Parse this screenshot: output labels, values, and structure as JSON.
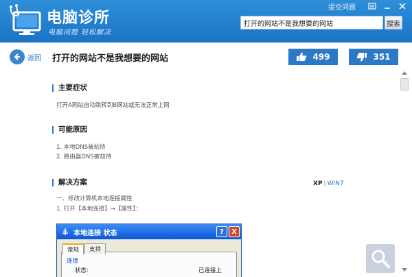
{
  "app": {
    "title": "电脑诊所",
    "slogan": "电脑问题  轻松解决"
  },
  "topbar": {
    "feedback": "提交问题"
  },
  "search": {
    "value": "打开的网站不是我想要的网站",
    "button_label": "搜索"
  },
  "nav": {
    "back_label": "返回"
  },
  "article": {
    "title": "打开的网站不是我想要的网站",
    "upvotes": "499",
    "downvotes": "351",
    "sections": [
      {
        "title": "主要症状",
        "lines": [
          "打开A网站自动跳转到B网站或无法正常上网"
        ]
      },
      {
        "title": "可能原因",
        "lines": [
          "1. 本地DNS被劫持",
          "2. 路由器DNS被劫持"
        ]
      },
      {
        "title": "解决方案",
        "lines": [
          "一、修改计算机本地连接属性",
          "1. 打开【本地连接】→【属性】："
        ]
      }
    ],
    "os_switch": {
      "xp": "XP",
      "separator": "|",
      "win7": "WIN7"
    }
  },
  "dialog": {
    "title": "本地连接  状态",
    "help_label": "?",
    "close_label": "X",
    "tabs": [
      "常规",
      "支持"
    ],
    "group": "连接",
    "row_label": "状态:",
    "row_value": "已连接上"
  },
  "colors": {
    "header": "#1f7bcb",
    "accent": "#2c7ac6",
    "link": "#2b78c2"
  }
}
